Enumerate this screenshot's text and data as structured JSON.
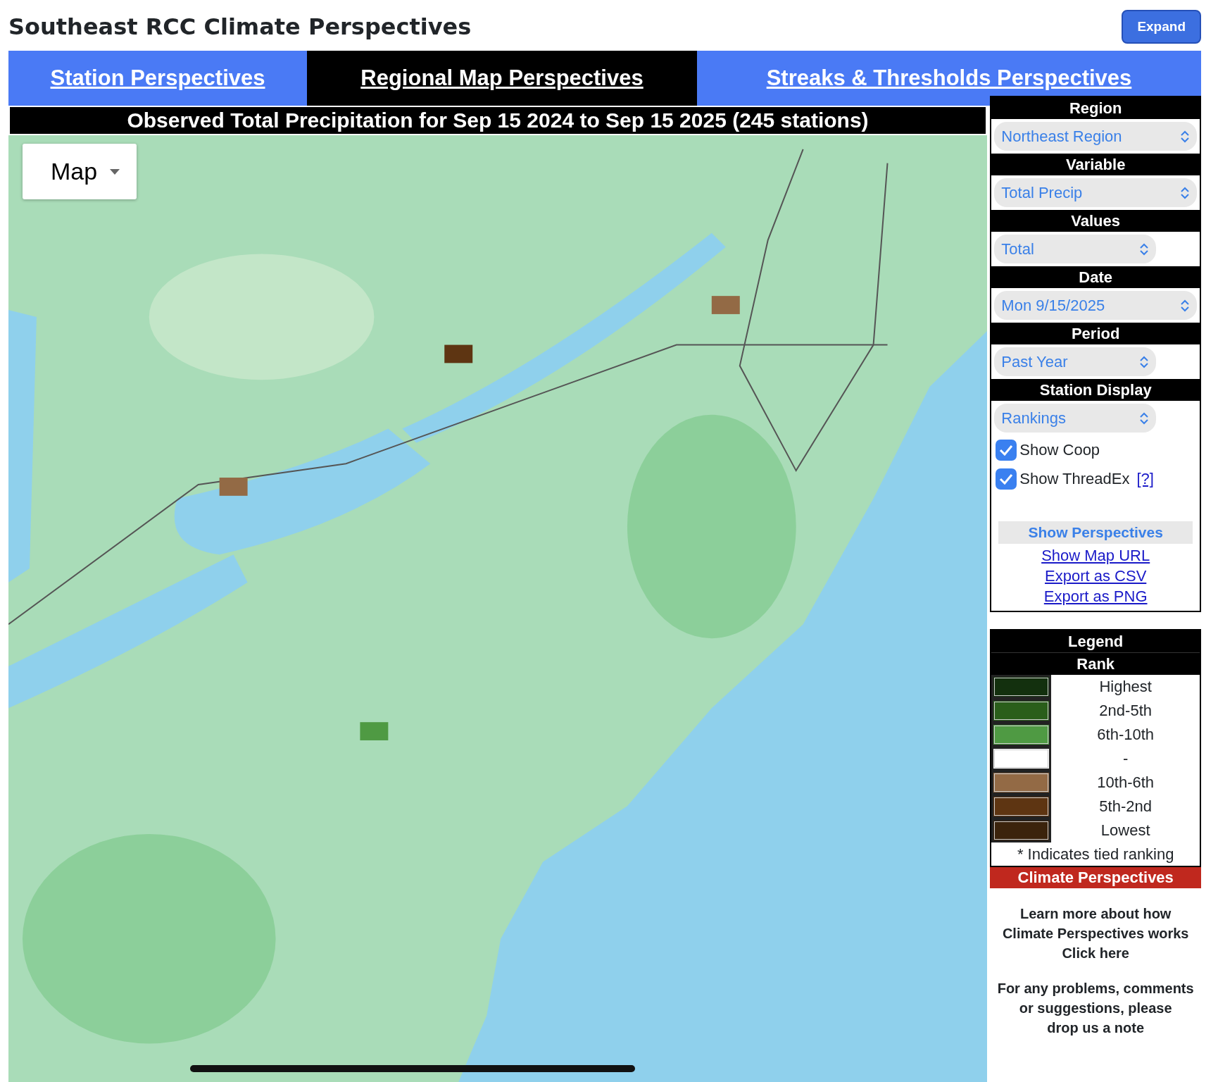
{
  "header": {
    "title": "Southeast RCC Climate Perspectives",
    "expand_button": "Expand"
  },
  "tabs": [
    {
      "label": "Station Perspectives",
      "selected": false
    },
    {
      "label": "Regional Map Perspectives",
      "selected": true
    },
    {
      "label": "Streaks & Thresholds Perspectives",
      "selected": false
    }
  ],
  "map": {
    "title": "Observed Total Precipitation for Sep 15 2024 to Sep 15 2025 (245 stations)",
    "view_control": "Map"
  },
  "controls": [
    {
      "heading": "Region",
      "value": "Northeast Region",
      "wide": true
    },
    {
      "heading": "Variable",
      "value": "Total Precip",
      "wide": true
    },
    {
      "heading": "Values",
      "value": "Total",
      "wide": false
    },
    {
      "heading": "Date",
      "value": "Mon 9/15/2025",
      "wide": true
    },
    {
      "heading": "Period",
      "value": "Past Year",
      "wide": false
    },
    {
      "heading": "Station Display",
      "value": "Rankings",
      "wide": false
    }
  ],
  "checkboxes": [
    {
      "label": "Show Coop",
      "checked": true
    },
    {
      "label": "Show ThreadEx",
      "checked": true,
      "help_link": "[?]"
    }
  ],
  "show_perspectives": "Show Perspectives",
  "links": [
    "Show Map URL",
    "Export as CSV",
    "Export as PNG"
  ],
  "legend": {
    "title": "Legend",
    "subtitle": "Rank",
    "items": [
      {
        "label": "Highest",
        "color": "#13300e"
      },
      {
        "label": "2nd-5th",
        "color": "#2a5e1a"
      },
      {
        "label": "6th-10th",
        "color": "#4f9a43"
      },
      {
        "label": "-",
        "color": "#ffffff"
      },
      {
        "label": "10th-6th",
        "color": "#936a45"
      },
      {
        "label": "5th-2nd",
        "color": "#5e3512"
      },
      {
        "label": "Lowest",
        "color": "#3b230c"
      }
    ],
    "note": "* Indicates tied ranking"
  },
  "banner": "Climate Perspectives",
  "learn_more": {
    "text": "Learn more about how Climate Perspectives works",
    "link": "Click here"
  },
  "feedback": {
    "text": "For any problems, comments or suggestions, please",
    "link": "drop us a note"
  }
}
